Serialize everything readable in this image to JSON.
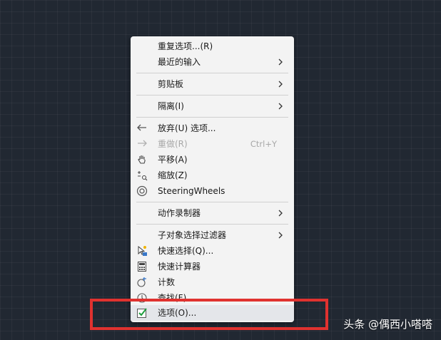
{
  "context_menu": {
    "items": [
      {
        "label": "重复选项...(R)"
      },
      {
        "label": "最近的输入"
      },
      {
        "label": "剪贴板"
      },
      {
        "label": "隔离(I)"
      },
      {
        "label": "放弃(U) 选项..."
      },
      {
        "label": "重做(R)",
        "shortcut": "Ctrl+Y"
      },
      {
        "label": "平移(A)"
      },
      {
        "label": "缩放(Z)"
      },
      {
        "label": "SteeringWheels"
      },
      {
        "label": "动作录制器"
      },
      {
        "label": "子对象选择过滤器"
      },
      {
        "label": "快速选择(Q)..."
      },
      {
        "label": "快速计算器"
      },
      {
        "label": "计数"
      },
      {
        "label": "查找(F)..."
      },
      {
        "label": "选项(O)..."
      }
    ]
  },
  "watermark": {
    "text": "头条 @偶西小嗒嗒"
  },
  "colors": {
    "highlight_box": "#e0322f",
    "canvas_bg": "#212832",
    "menu_bg": "#f3f3f3"
  }
}
